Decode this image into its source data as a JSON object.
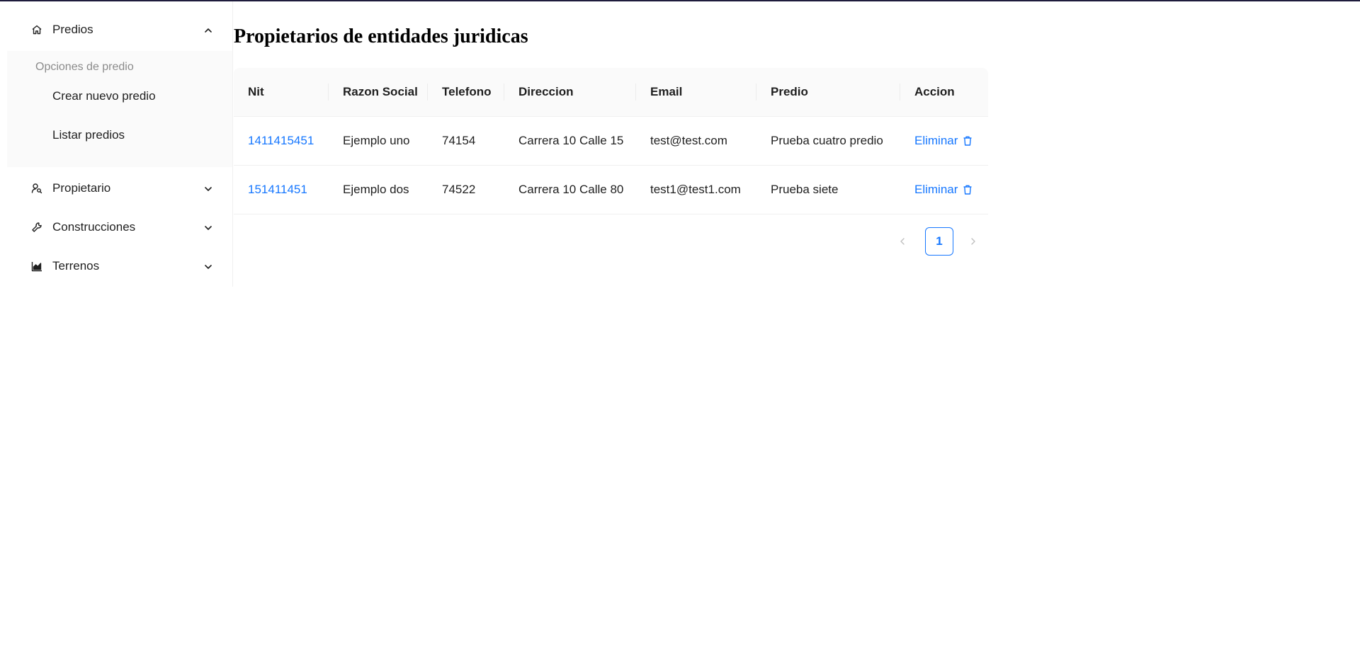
{
  "sidebar": {
    "predios": {
      "label": "Predios",
      "group_title": "Opciones de predio",
      "items": [
        {
          "label": "Crear nuevo predio"
        },
        {
          "label": "Listar predios"
        }
      ]
    },
    "propietario": {
      "label": "Propietario"
    },
    "construcciones": {
      "label": "Construcciones"
    },
    "terrenos": {
      "label": "Terrenos"
    }
  },
  "main": {
    "title": "Propietarios de entidades juridicas",
    "table": {
      "columns": [
        "Nit",
        "Razon Social",
        "Telefono",
        "Direccion",
        "Email",
        "Predio",
        "Accion"
      ],
      "rows": [
        {
          "nit": "1411415451",
          "razon_social": "Ejemplo uno",
          "telefono": "74154",
          "direccion": "Carrera 10 Calle 15",
          "email": "test@test.com",
          "predio": "Prueba cuatro predio",
          "accion": "Eliminar"
        },
        {
          "nit": "151411451",
          "razon_social": "Ejemplo dos",
          "telefono": "74522",
          "direccion": "Carrera 10 Calle 80",
          "email": "test1@test1.com",
          "predio": "Prueba siete",
          "accion": "Eliminar"
        }
      ]
    },
    "pagination": {
      "current_page": "1"
    }
  },
  "colors": {
    "accent": "#1677ff",
    "top_bar": "#1e1b3c",
    "submenu_bg": "#fafafa",
    "header_bg": "#fafafa"
  },
  "icons": [
    "home-icon",
    "chevron-up-icon",
    "user-search-icon",
    "chevron-down-icon",
    "wrench-icon",
    "area-chart-icon",
    "trash-icon",
    "chevron-left-icon",
    "chevron-right-icon"
  ]
}
